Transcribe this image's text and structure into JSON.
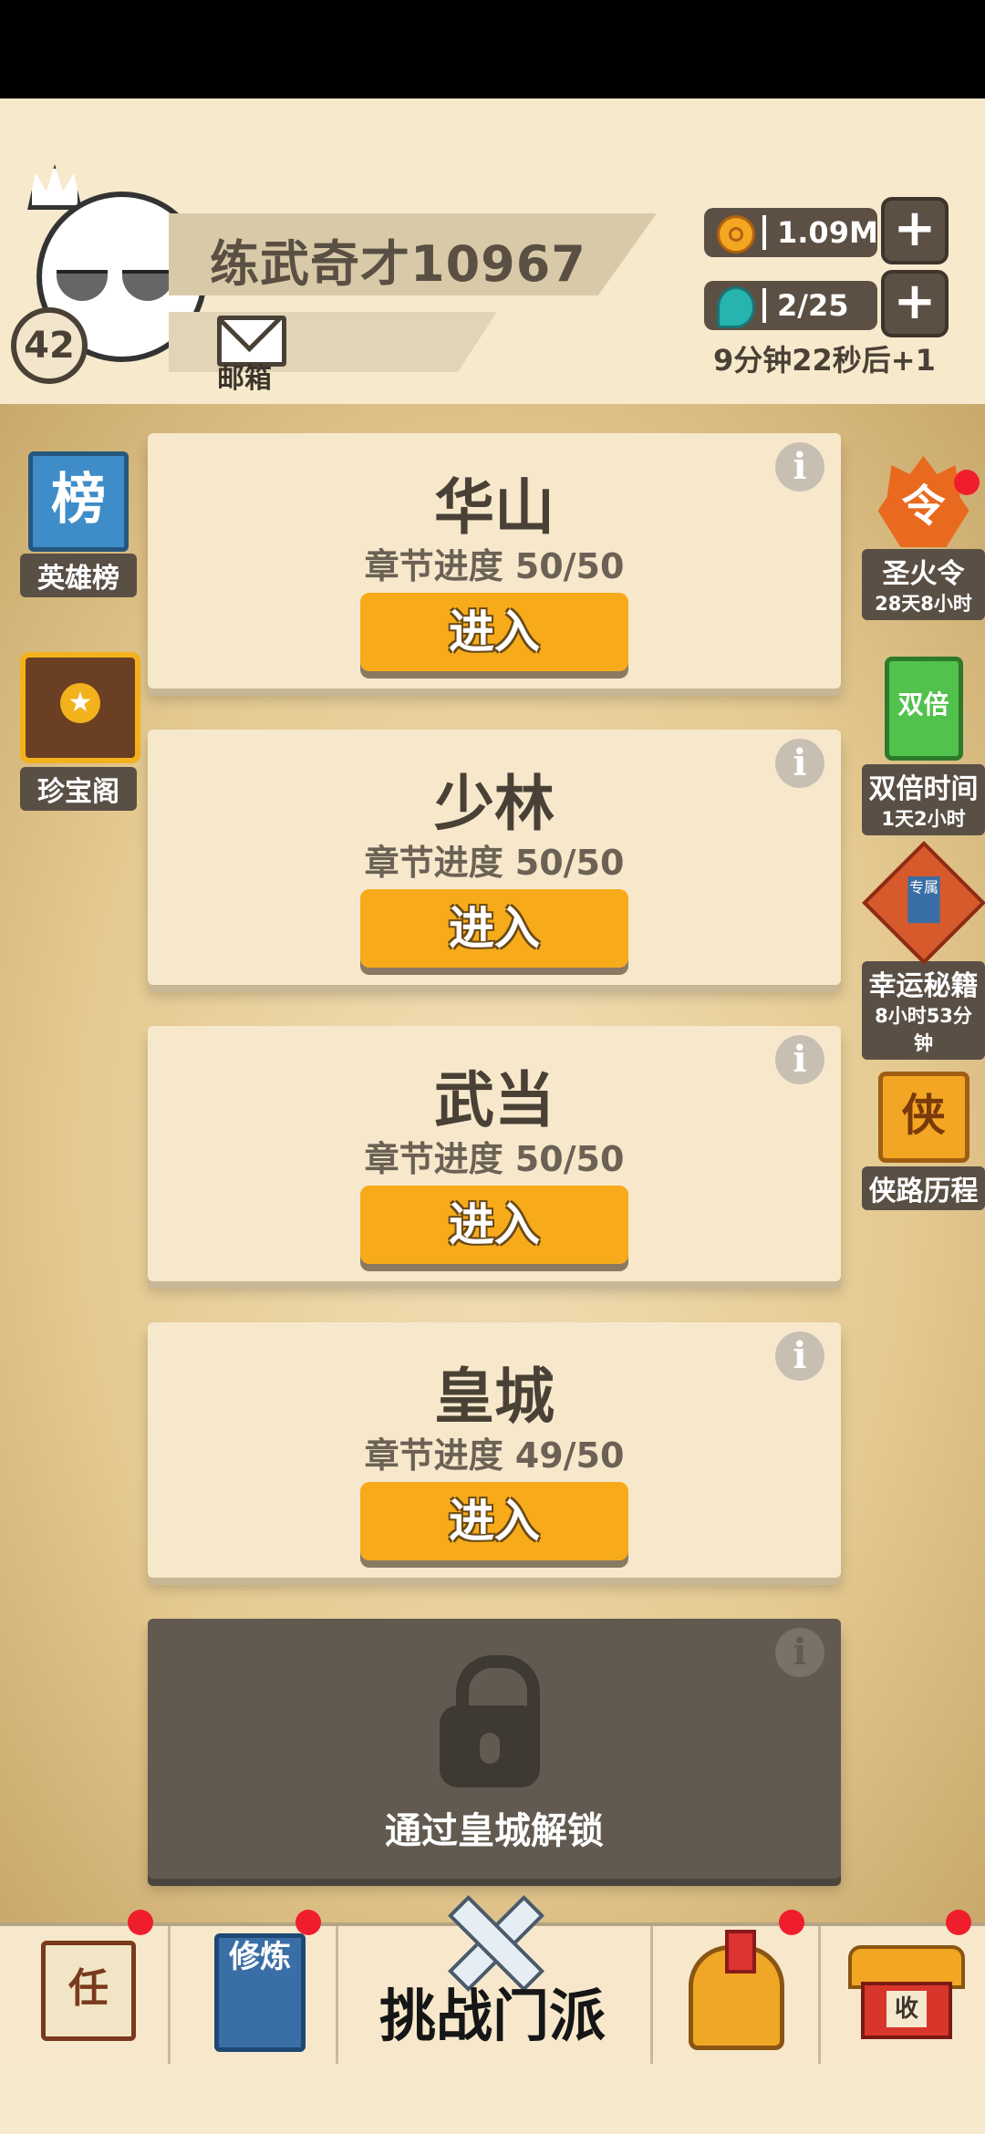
{
  "player": {
    "name": "练武奇才10967",
    "level": "42",
    "mail_label": "邮箱"
  },
  "resources": {
    "coins": "1.09M",
    "stamina": "2/25",
    "stamina_timer": "9分钟22秒后+1"
  },
  "left_sidebar": [
    {
      "label": "英雄榜",
      "icon_text": "榜",
      "icon": "leaderboard-icon"
    },
    {
      "label": "珍宝阁",
      "icon": "treasure-chest-icon"
    }
  ],
  "right_sidebar": [
    {
      "label": "圣火令",
      "sub": "28天8小时",
      "icon_text": "令",
      "icon": "sacred-fire-icon"
    },
    {
      "label": "双倍时间",
      "sub": "1天2小时",
      "icon_text": "双倍",
      "icon": "double-time-icon"
    },
    {
      "label": "幸运秘籍",
      "sub": "8小时53分钟",
      "icon_text": "专属",
      "icon": "lucky-book-icon"
    },
    {
      "label": "侠路历程",
      "icon_text": "侠",
      "icon": "hero-journey-icon"
    }
  ],
  "sects": [
    {
      "name": "华山",
      "progress": "章节进度 50/50",
      "button": "进入"
    },
    {
      "name": "少林",
      "progress": "章节进度 50/50",
      "button": "进入"
    },
    {
      "name": "武当",
      "progress": "章节进度 50/50",
      "button": "进入"
    },
    {
      "name": "皇城",
      "progress": "章节进度 49/50",
      "button": "进入"
    }
  ],
  "locked": {
    "text": "通过皇城解锁"
  },
  "bottom_nav": {
    "task_icon_text": "任",
    "cultivate_icon_text": "修炼",
    "challenge_label": "挑战门派",
    "shop_icon_text": "收"
  },
  "info_glyph": "i",
  "colors": {
    "enter_button": "#f7ab1b",
    "notification_dot": "#f01d2c",
    "locked_card": "#625a50"
  }
}
